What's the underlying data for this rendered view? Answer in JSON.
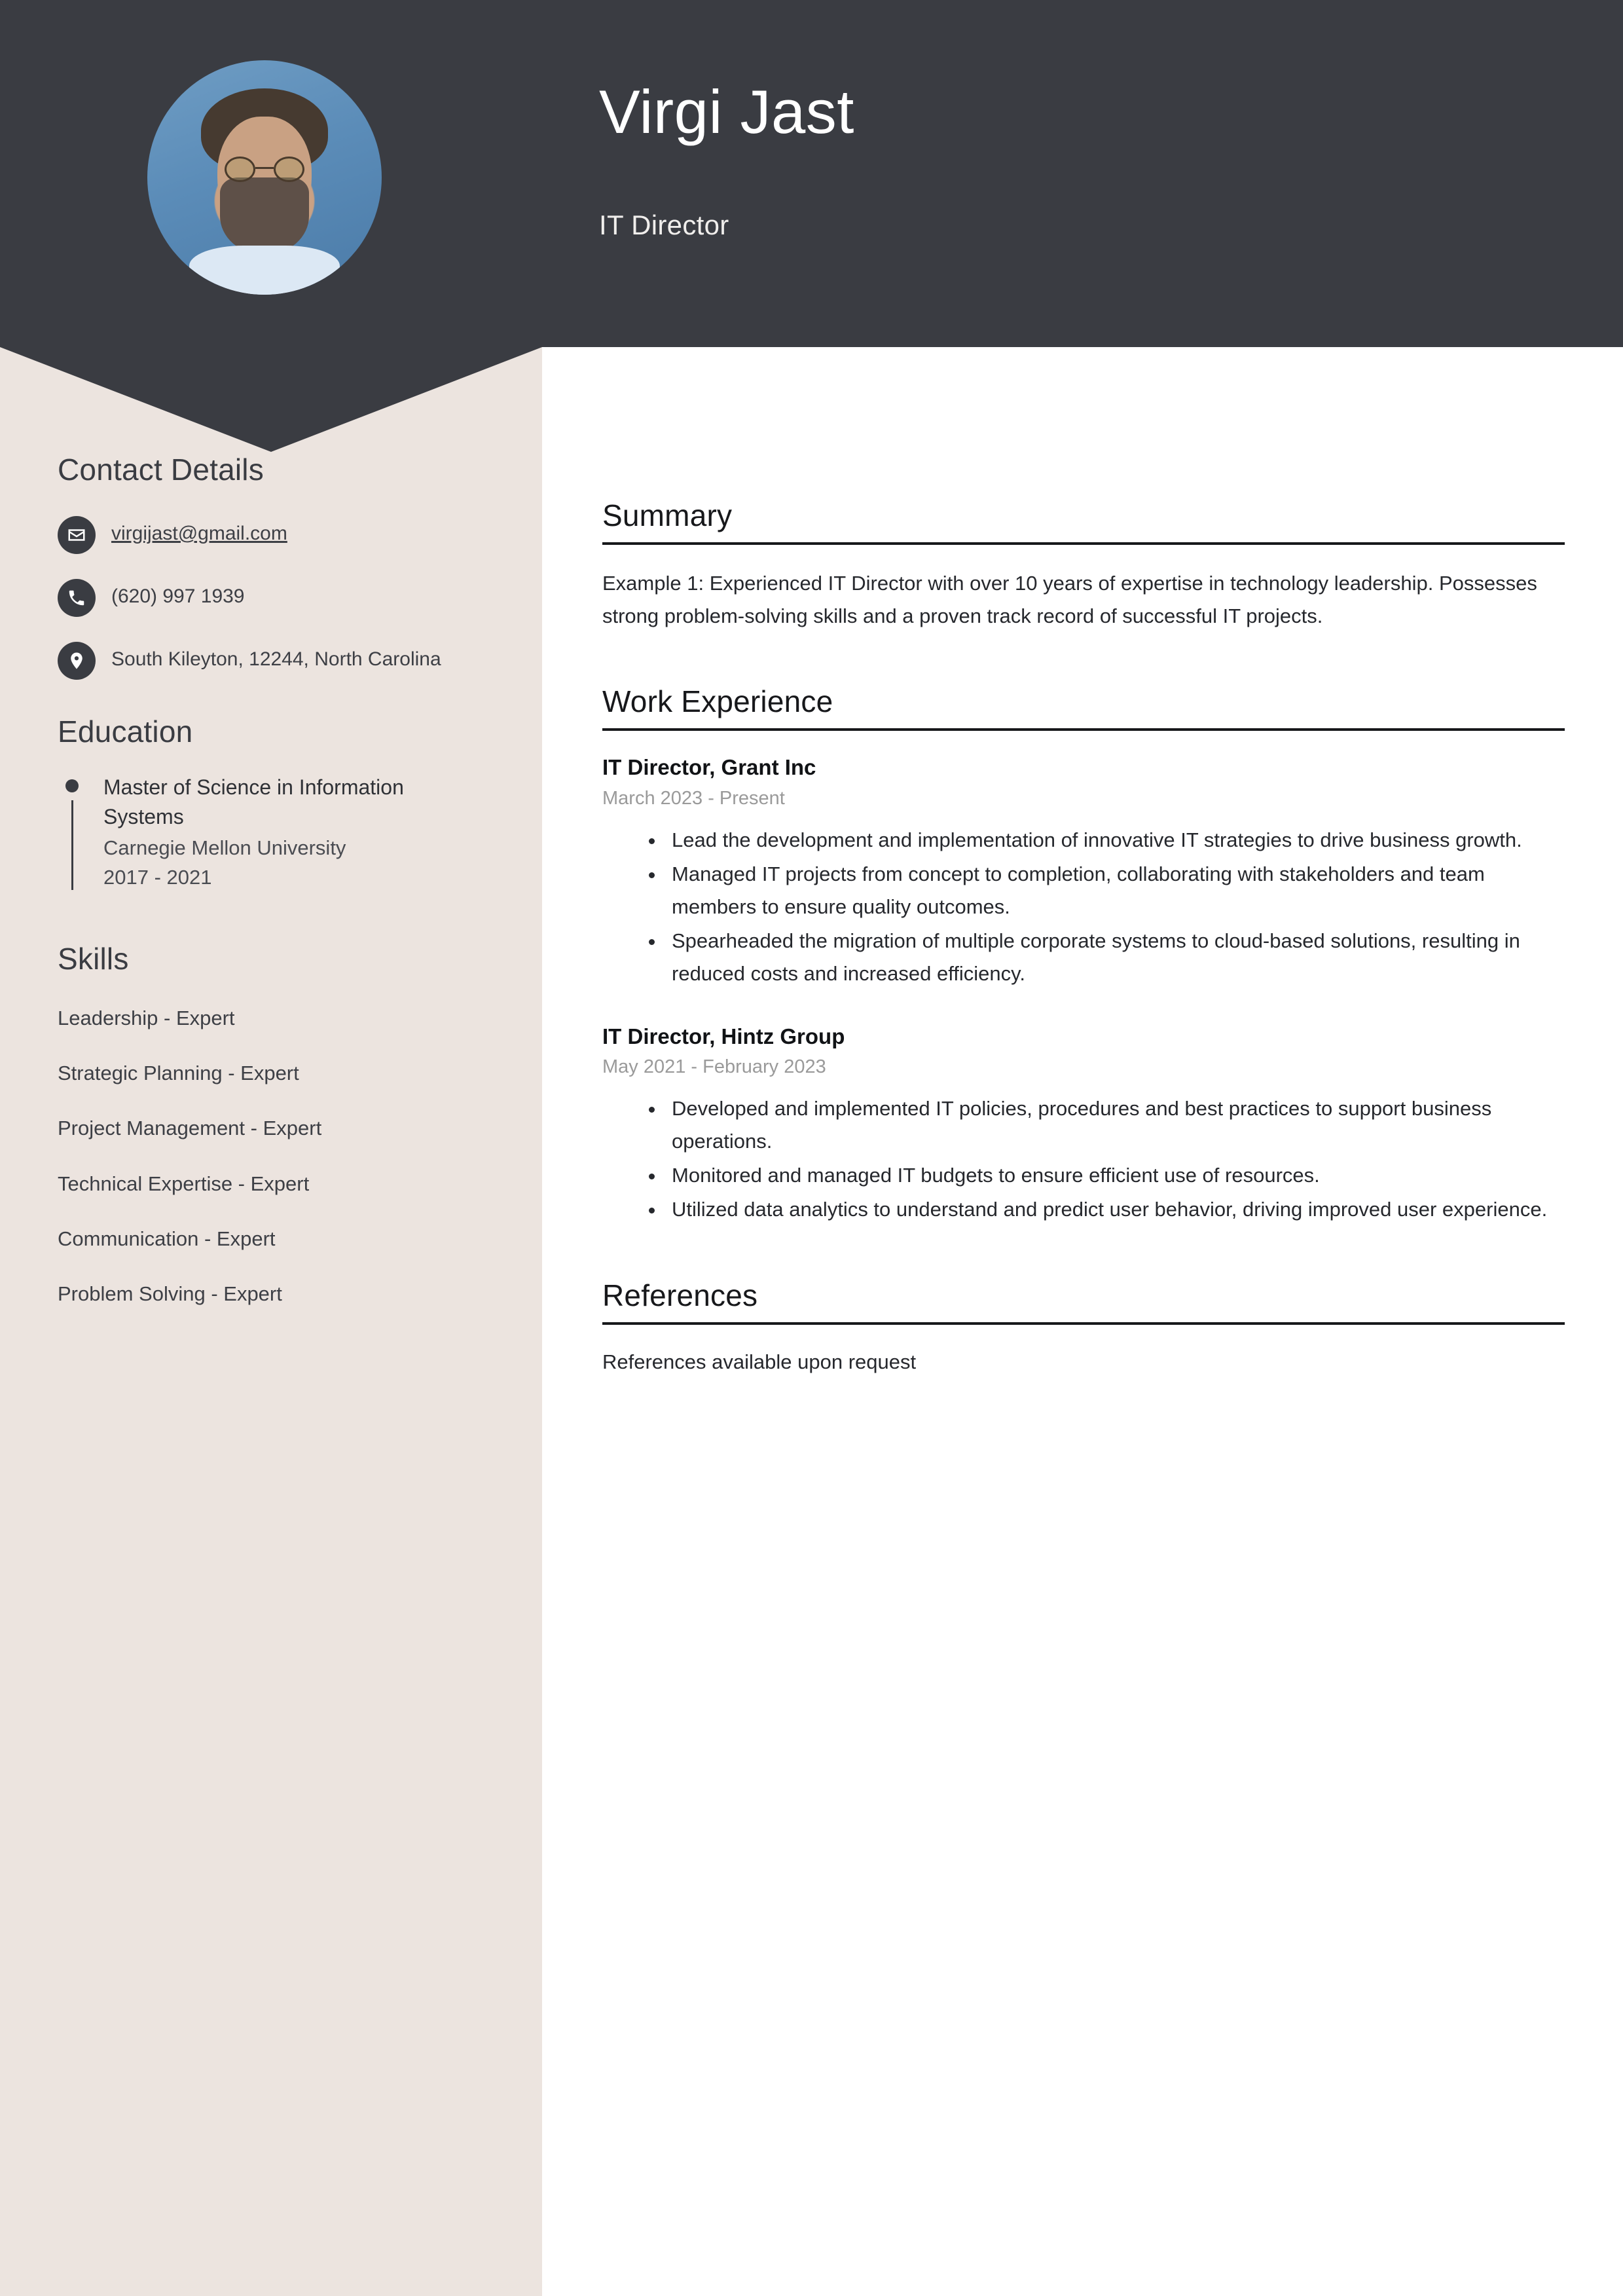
{
  "theme": {
    "header_bg": "#3a3c42",
    "sidebar_bg": "#ece4df",
    "page_bg": "#ffffff",
    "rule_color": "#17181b",
    "muted_text": "#9a9a9a"
  },
  "header": {
    "name": "Virgi Jast",
    "role": "IT Director",
    "avatar_alt": "profile-photo"
  },
  "sidebar": {
    "contact": {
      "heading": "Contact Details",
      "items": [
        {
          "icon": "envelope-icon",
          "value": "virgijast@gmail.com",
          "link": true
        },
        {
          "icon": "phone-icon",
          "value": "(620) 997 1939",
          "link": false
        },
        {
          "icon": "location-pin-icon",
          "value": "South Kileyton, 12244, North Carolina",
          "link": false
        }
      ]
    },
    "education": {
      "heading": "Education",
      "entries": [
        {
          "degree": "Master of Science in Information Systems",
          "school": "Carnegie Mellon University",
          "dates": "2017 - 2021"
        }
      ]
    },
    "skills": {
      "heading": "Skills",
      "items": [
        "Leadership - Expert",
        "Strategic Planning - Expert",
        "Project Management - Expert",
        "Technical Expertise - Expert",
        "Communication - Expert",
        "Problem Solving - Expert"
      ]
    }
  },
  "main": {
    "summary": {
      "heading": "Summary",
      "text": "Example 1: Experienced IT Director with over 10 years of expertise in technology leadership. Possesses strong problem-solving skills and a proven track record of successful IT projects."
    },
    "work_experience": {
      "heading": "Work Experience",
      "jobs": [
        {
          "title": "IT Director, Grant Inc",
          "dates": "March 2023 - Present",
          "bullets": [
            "Lead the development and implementation of innovative IT strategies to drive business growth.",
            "Managed IT projects from concept to completion, collaborating with stakeholders and team members to ensure quality outcomes.",
            "Spearheaded the migration of multiple corporate systems to cloud-based solutions, resulting in reduced costs and increased efficiency."
          ]
        },
        {
          "title": "IT Director, Hintz Group",
          "dates": "May 2021 - February 2023",
          "bullets": [
            "Developed and implemented IT policies, procedures and best practices to support business operations.",
            "Monitored and managed IT budgets to ensure efficient use of resources.",
            "Utilized data analytics to understand and predict user behavior, driving improved user experience."
          ]
        }
      ]
    },
    "references": {
      "heading": "References",
      "text": "References available upon request"
    }
  }
}
